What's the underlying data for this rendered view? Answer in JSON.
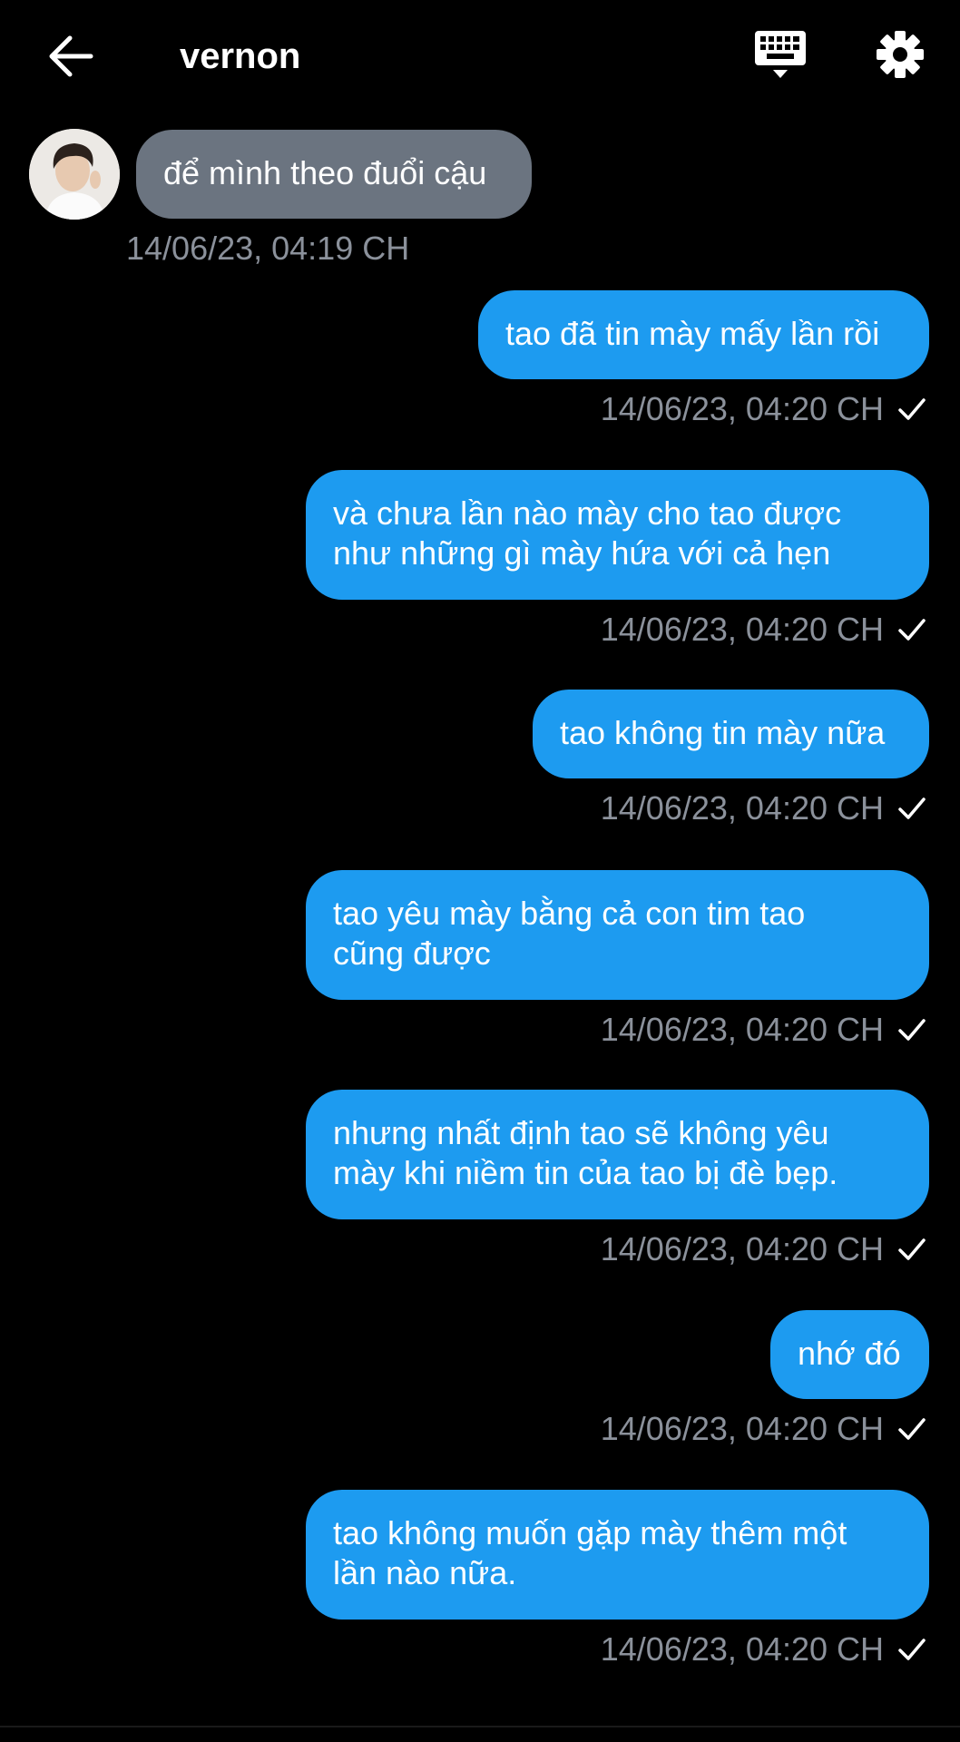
{
  "header": {
    "title": "vernon",
    "back_icon": "arrow-left-icon",
    "keyboard_icon": "keyboard-icon",
    "settings_icon": "gear-icon"
  },
  "colors": {
    "background": "#000000",
    "incoming_bubble": "#6b7480",
    "outgoing_bubble": "#1d9bf0",
    "timestamp": "#8b919b"
  },
  "messages": [
    {
      "from": "them",
      "lines": [
        "để mình theo đuổi cậu"
      ],
      "time": "14/06/23, 04:19 CH"
    },
    {
      "from": "me",
      "lines": [
        "tao đã tin mày mấy lần rồi"
      ],
      "time": "14/06/23, 04:20 CH"
    },
    {
      "from": "me",
      "lines": [
        "và chưa lần nào mày cho tao được",
        "như những gì mày hứa với cả hẹn"
      ],
      "time": "14/06/23, 04:20 CH"
    },
    {
      "from": "me",
      "lines": [
        "tao không tin mày nữa"
      ],
      "time": "14/06/23, 04:20 CH"
    },
    {
      "from": "me",
      "lines": [
        "tao yêu mày bằng cả con tim tao",
        "cũng được"
      ],
      "time": "14/06/23, 04:20 CH"
    },
    {
      "from": "me",
      "lines": [
        "nhưng nhất định tao sẽ không yêu",
        "mày khi niềm tin của tao bị đè bẹp."
      ],
      "time": "14/06/23, 04:20 CH"
    },
    {
      "from": "me",
      "lines": [
        "nhớ đó"
      ],
      "time": "14/06/23, 04:20 CH"
    },
    {
      "from": "me",
      "lines": [
        "tao không muốn gặp mày thêm một",
        "lần nào nữa."
      ],
      "time": "14/06/23, 04:20 CH"
    }
  ]
}
